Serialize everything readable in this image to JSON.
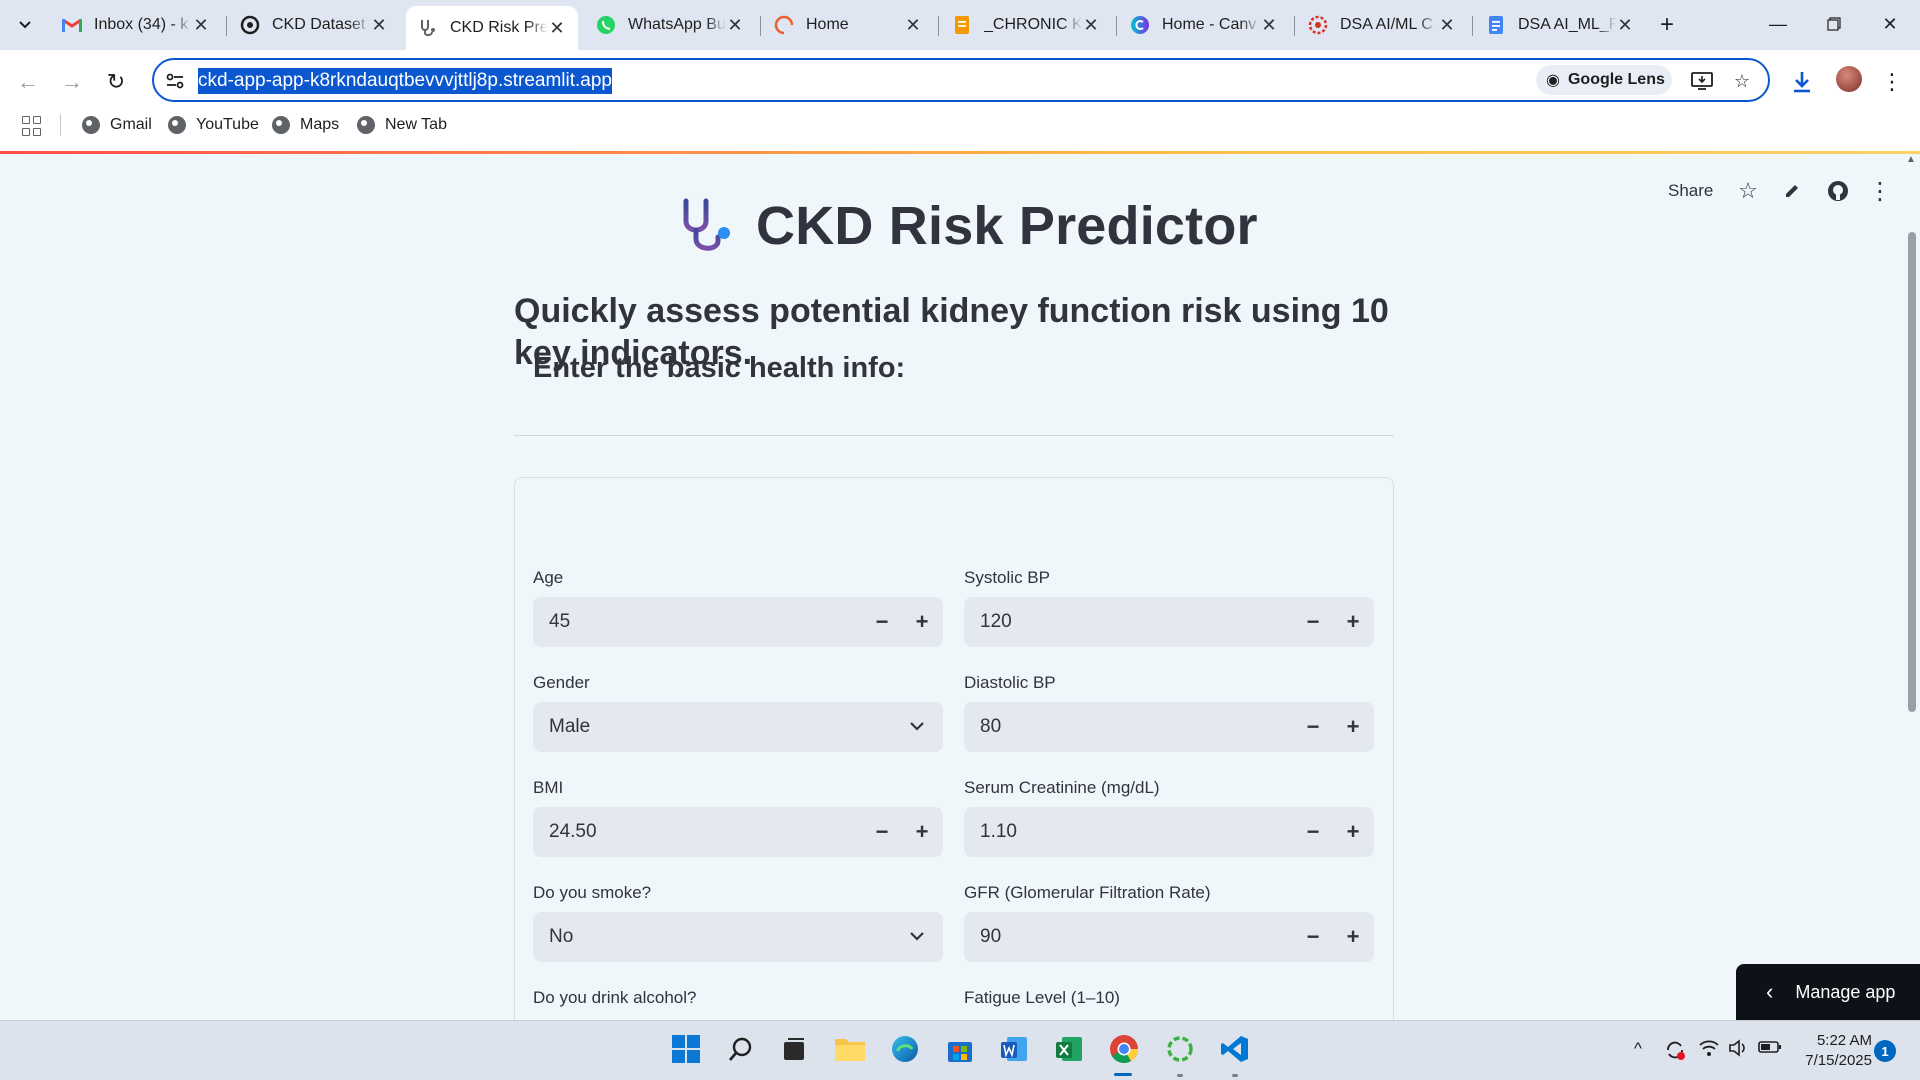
{
  "browser": {
    "tabs": [
      {
        "title": "Inbox (34) - k",
        "icon": "gmail-icon"
      },
      {
        "title": "CKD Dataset",
        "icon": "openai-icon"
      },
      {
        "title": "CKD Risk Pre",
        "icon": "stethoscope-icon"
      },
      {
        "title": "WhatsApp Bu",
        "icon": "whatsapp-icon"
      },
      {
        "title": "Home",
        "icon": "loading-icon"
      },
      {
        "title": "_CHRONIC K",
        "icon": "docs-icon"
      },
      {
        "title": "Home - Canv",
        "icon": "canva-icon"
      },
      {
        "title": "DSA AI/ML C",
        "icon": "dsa-icon"
      },
      {
        "title": "DSA AI_ML_F",
        "icon": "docs-icon"
      }
    ],
    "url": "ckd-app-app-k8rkndauqtbevvvjttlj8p.streamlit.app",
    "lens_label": "Google Lens",
    "bookmarks": [
      "Gmail",
      "YouTube",
      "Maps",
      "New Tab"
    ]
  },
  "streamlit": {
    "share_label": "Share",
    "manage_label": "Manage app"
  },
  "app": {
    "title": "CKD Risk Predictor",
    "subtitle": "Quickly assess potential kidney function risk using 10 key indicators.",
    "form_title": "Enter the basic health info:",
    "fields": {
      "age": {
        "label": "Age",
        "value": "45"
      },
      "gender": {
        "label": "Gender",
        "value": "Male"
      },
      "bmi": {
        "label": "BMI",
        "value": "24.50"
      },
      "smoke": {
        "label": "Do you smoke?",
        "value": "No"
      },
      "alcohol": {
        "label": "Do you drink alcohol?"
      },
      "systolic": {
        "label": "Systolic BP",
        "value": "120"
      },
      "diastolic": {
        "label": "Diastolic BP",
        "value": "80"
      },
      "creatinine": {
        "label": "Serum Creatinine (mg/dL)",
        "value": "1.10"
      },
      "gfr": {
        "label": "GFR (Glomerular Filtration Rate)",
        "value": "90"
      },
      "fatigue": {
        "label": "Fatigue Level (1–10)"
      }
    }
  },
  "taskbar": {
    "time": "5:22 AM",
    "date": "7/15/2025",
    "notifications": "1"
  }
}
